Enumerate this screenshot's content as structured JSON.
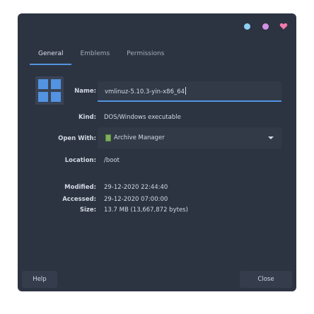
{
  "window_controls": {
    "minimize_color": "#8fd0f6",
    "maximize_color": "#d291e3",
    "close_color": "#f27aab"
  },
  "tabs": [
    {
      "label": "General",
      "active": true
    },
    {
      "label": "Emblems",
      "active": false
    },
    {
      "label": "Permissions",
      "active": false
    }
  ],
  "file_icon": "window-grid-icon",
  "fields": {
    "name_label": "Name:",
    "name_value": "vmlinuz-5.10.3-yin-x86_64",
    "kind_label": "Kind:",
    "kind_value": "DOS/Windows executable",
    "open_with_label": "Open With:",
    "open_with_value": "Archive Manager",
    "location_label": "Location:",
    "location_value": "/boot",
    "modified_label": "Modified:",
    "modified_value": "29-12-2020 22:44:40",
    "accessed_label": "Accessed:",
    "accessed_value": "29-12-2020 07:00:00",
    "size_label": "Size:",
    "size_value": "13.7 MB (13,667,872 bytes)"
  },
  "footer": {
    "help_label": "Help",
    "close_label": "Close"
  },
  "colors": {
    "background": "#2c3341",
    "accent": "#5294e2",
    "text": "#d3dae3"
  }
}
